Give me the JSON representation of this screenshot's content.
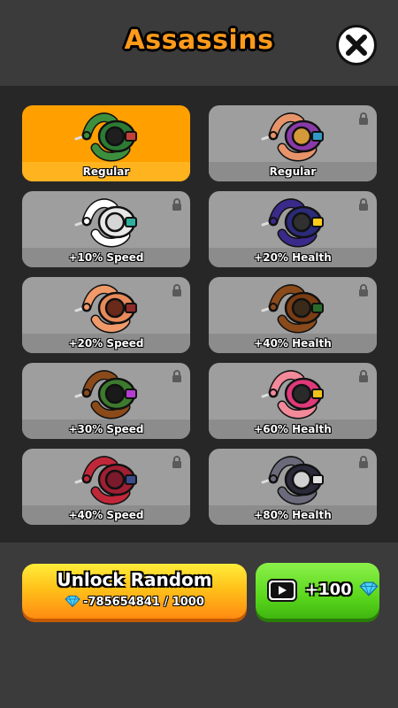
{
  "header": {
    "title": "Assassins"
  },
  "skins": [
    {
      "label": "Regular",
      "locked": false,
      "selected": true,
      "skin": "#3d8f3d",
      "body": "#2d7a34",
      "accent": "#c0413b",
      "hair": "#1f1f1f"
    },
    {
      "label": "Regular",
      "locked": true,
      "selected": false,
      "skin": "#e8946a",
      "body": "#8a3aa8",
      "accent": "#2f9ac4",
      "hair": "#d49a3a"
    },
    {
      "label": "+10% Speed",
      "locked": true,
      "selected": false,
      "skin": "#ffffff",
      "body": "#e8e8e8",
      "accent": "#2fae9e",
      "hair": "#d6d6d6"
    },
    {
      "label": "+20% Health",
      "locked": true,
      "selected": false,
      "skin": "#3a2a8a",
      "body": "#2b2b7a",
      "accent": "#ffcc1a",
      "hair": "#303030"
    },
    {
      "label": "+20% Speed",
      "locked": true,
      "selected": false,
      "skin": "#f09a6a",
      "body": "#e88a5a",
      "accent": "#8f2a2a",
      "hair": "#6a2a1a"
    },
    {
      "label": "+40% Health",
      "locked": true,
      "selected": false,
      "skin": "#8a4a1a",
      "body": "#7a3c12",
      "accent": "#2a6a2a",
      "hair": "#3a2a1a"
    },
    {
      "label": "+30% Speed",
      "locked": true,
      "selected": false,
      "skin": "#8a4a1a",
      "body": "#3c7a2e",
      "accent": "#b43cd0",
      "hair": "#1a1a1a"
    },
    {
      "label": "+60% Health",
      "locked": true,
      "selected": false,
      "skin": "#f28a9a",
      "body": "#e0397a",
      "accent": "#f2c21a",
      "hair": "#2a2a2a"
    },
    {
      "label": "+40% Speed",
      "locked": true,
      "selected": false,
      "skin": "#c0283a",
      "body": "#a01f32",
      "accent": "#3a4a8a",
      "hair": "#7a1a2a"
    },
    {
      "label": "+80% Health",
      "locked": true,
      "selected": false,
      "skin": "#6a6a7a",
      "body": "#2a2a3a",
      "accent": "#e0e0e0",
      "hair": "#d0d0d0"
    }
  ],
  "actions": {
    "unlock_label": "Unlock Random",
    "unlock_cost": "-785654841 / 1000",
    "video_reward": "+100"
  },
  "icons": {
    "close": "close-icon",
    "lock": "lock-icon",
    "gem": "gem-icon",
    "video": "play-video-icon"
  },
  "colors": {
    "selected_card": "#ffa000",
    "locked_card": "#9e9e9e",
    "title": "#ff9a1a",
    "video_button": "#5bd81d",
    "gem": "#47d4ff"
  }
}
